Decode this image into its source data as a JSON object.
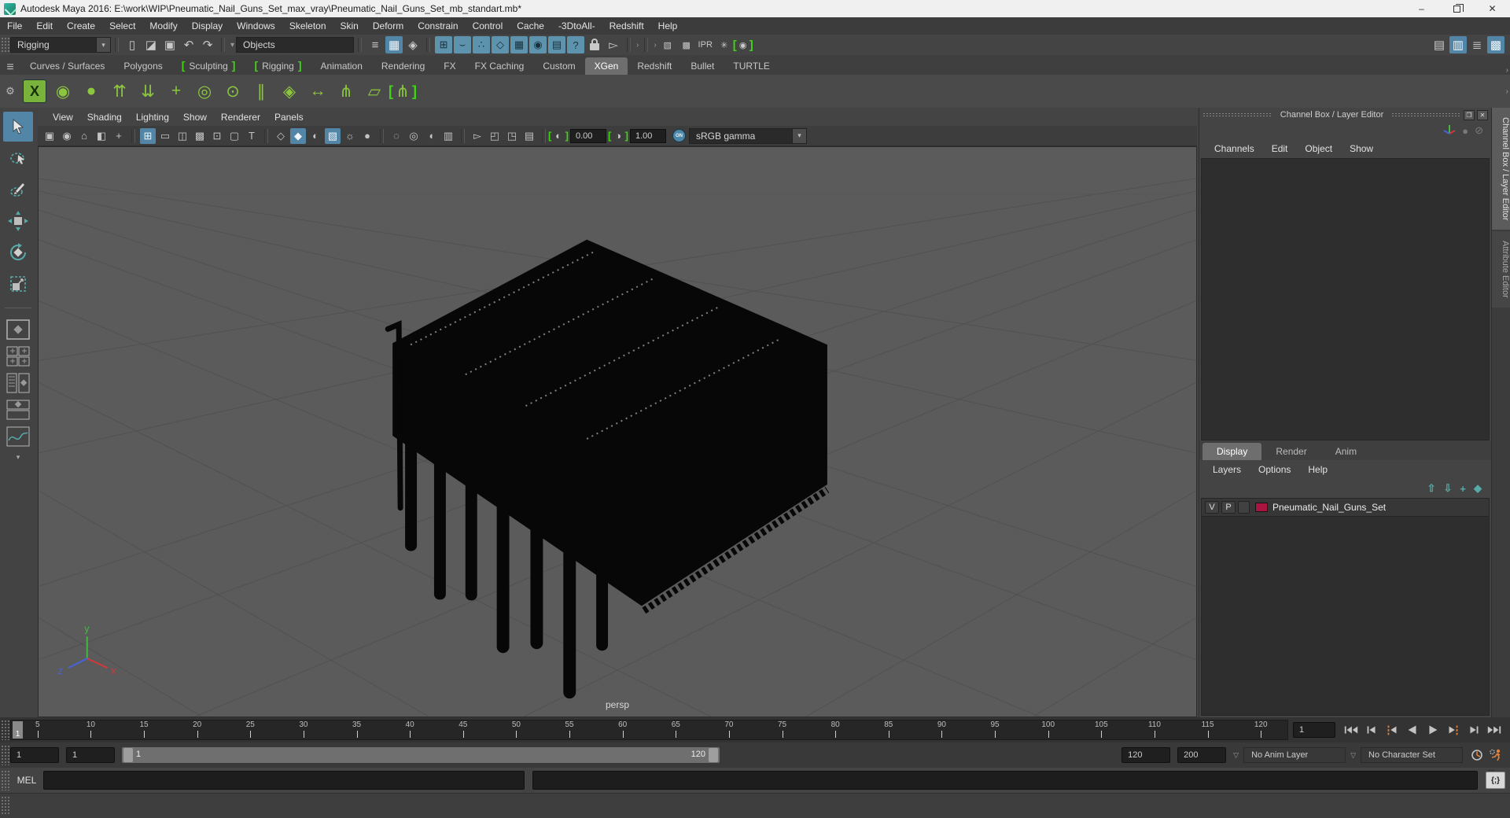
{
  "window": {
    "title": "Autodesk Maya 2016: E:\\work\\WIP\\Pneumatic_Nail_Guns_Set_max_vray\\Pneumatic_Nail_Guns_Set_mb_standart.mb*",
    "minimize_glyph": "–",
    "close_glyph": "✕"
  },
  "menu_bar": {
    "items": [
      {
        "label": "File"
      },
      {
        "label": "Edit"
      },
      {
        "label": "Create"
      },
      {
        "label": "Select"
      },
      {
        "label": "Modify"
      },
      {
        "label": "Display"
      },
      {
        "label": "Windows"
      },
      {
        "label": "Skeleton"
      },
      {
        "label": "Skin"
      },
      {
        "label": "Deform"
      },
      {
        "label": "Constrain"
      },
      {
        "label": "Control"
      },
      {
        "label": "Cache"
      },
      {
        "label": "-3DtoAll-"
      },
      {
        "label": "Redshift"
      },
      {
        "label": "Help"
      }
    ]
  },
  "status_line": {
    "menuset": "Rigging",
    "selection_mask": "Objects",
    "file_icons": [
      {
        "name": "new-scene-icon",
        "glyph": "▯"
      },
      {
        "name": "open-scene-icon",
        "glyph": "◪"
      },
      {
        "name": "save-scene-icon",
        "glyph": "▣"
      },
      {
        "name": "undo-icon",
        "glyph": "↶"
      },
      {
        "name": "redo-icon",
        "glyph": "↷"
      }
    ],
    "selection_mode_icons": [
      {
        "name": "hierarchy-mode-icon",
        "glyph": "≡"
      },
      {
        "name": "object-mode-icon",
        "glyph": "▦",
        "active": true
      },
      {
        "name": "component-mode-icon",
        "glyph": "◈"
      }
    ],
    "snap_icons": [
      {
        "name": "snap-grid-icon",
        "glyph": "⊞"
      },
      {
        "name": "snap-curve-icon",
        "glyph": "⌣"
      },
      {
        "name": "snap-point-icon",
        "glyph": "∴"
      },
      {
        "name": "snap-projected-center-icon",
        "glyph": "◇"
      },
      {
        "name": "snap-view-plane-icon",
        "glyph": "▦"
      },
      {
        "name": "make-live-icon",
        "glyph": "◉"
      },
      {
        "name": "construction-history-icon",
        "glyph": "▤"
      },
      {
        "name": "help-line-icon",
        "glyph": "?"
      }
    ],
    "render_icons": [
      {
        "name": "render-view-icon",
        "glyph": "▧"
      },
      {
        "name": "render-current-frame-icon",
        "glyph": "▩"
      },
      {
        "name": "ipr-render-icon",
        "glyph": "IPR"
      },
      {
        "name": "render-settings-icon",
        "glyph": "✳"
      },
      {
        "name": "color-management-icon",
        "glyph": "◉",
        "bracket": true
      }
    ],
    "panel_toggle_icons": [
      {
        "name": "modeling-toolkit-icon",
        "glyph": "▤"
      },
      {
        "name": "tool-settings-icon",
        "glyph": "▥",
        "active": true
      },
      {
        "name": "attribute-editor-icon",
        "glyph": "≣"
      },
      {
        "name": "channel-box-toggle-icon",
        "glyph": "▩",
        "active": true
      }
    ]
  },
  "shelf": {
    "tabs": [
      {
        "label": "Curves / Surfaces"
      },
      {
        "label": "Polygons"
      },
      {
        "label": "Sculpting",
        "bracket": true
      },
      {
        "label": "Rigging",
        "bracket": true
      },
      {
        "label": "Animation"
      },
      {
        "label": "Rendering"
      },
      {
        "label": "FX"
      },
      {
        "label": "FX Caching"
      },
      {
        "label": "Custom"
      },
      {
        "label": "XGen",
        "active": true
      },
      {
        "label": "Redshift"
      },
      {
        "label": "Bullet"
      },
      {
        "label": "TURTLE"
      }
    ],
    "tools": [
      {
        "name": "xgen-editor-icon",
        "glyph": "X",
        "boxed": true
      },
      {
        "name": "xgen-description-icon",
        "glyph": "◉"
      },
      {
        "name": "xgen-collection-icon",
        "glyph": "●"
      },
      {
        "name": "xgen-add-guides-icon",
        "glyph": "⇈"
      },
      {
        "name": "xgen-place-guides-icon",
        "glyph": "⇊"
      },
      {
        "name": "xgen-add-guide-icon",
        "glyph": "+"
      },
      {
        "name": "xgen-toggle-guide-icon",
        "glyph": "◎"
      },
      {
        "name": "xgen-lock-guide-icon",
        "glyph": "⊙"
      },
      {
        "name": "xgen-guides-icon",
        "glyph": "∥"
      },
      {
        "name": "xgen-export-patches-icon",
        "glyph": "◈"
      },
      {
        "name": "xgen-width-icon",
        "glyph": "↔"
      },
      {
        "name": "xgen-groom-icon",
        "glyph": "⋔"
      },
      {
        "name": "xgen-region-icon",
        "glyph": "▱"
      },
      {
        "name": "xgen-delete-guides-icon",
        "glyph": "⋔",
        "bracket": true
      }
    ]
  },
  "toolbox": {
    "tools": [
      "select-tool",
      "lasso-tool",
      "paint-selection-tool",
      "move-tool",
      "rotate-tool",
      "scale-tool"
    ],
    "layouts": [
      "single-pane-layout",
      "four-pane-layout",
      "outliner-persp-layout",
      "persp-outliner-layout",
      "persp-graph-layout"
    ]
  },
  "viewport": {
    "menus": [
      {
        "label": "View"
      },
      {
        "label": "Shading"
      },
      {
        "label": "Lighting"
      },
      {
        "label": "Show"
      },
      {
        "label": "Renderer"
      },
      {
        "label": "Panels"
      }
    ],
    "toolbar_g1": [
      {
        "name": "select-camera-icon",
        "glyph": "▣"
      },
      {
        "name": "camera-attributes-icon",
        "glyph": "◉"
      },
      {
        "name": "bookmark-icon",
        "glyph": "⌂"
      },
      {
        "name": "image-plane-icon",
        "glyph": "◧"
      },
      {
        "name": "two-d-pan-zoom-icon",
        "glyph": "+"
      }
    ],
    "toolbar_g2": [
      {
        "name": "grid-icon",
        "glyph": "⊞",
        "active": true
      },
      {
        "name": "film-gate-icon",
        "glyph": "▭"
      },
      {
        "name": "resolution-gate-icon",
        "glyph": "◫"
      },
      {
        "name": "gate-mask-icon",
        "glyph": "▩"
      },
      {
        "name": "field-chart-icon",
        "glyph": "⊡"
      },
      {
        "name": "safe-action-icon",
        "glyph": "▢"
      },
      {
        "name": "safe-title-icon",
        "glyph": "T"
      }
    ],
    "toolbar_g3": [
      {
        "name": "wireframe-icon",
        "glyph": "◇"
      },
      {
        "name": "smooth-shade-icon",
        "glyph": "◆",
        "active": true
      },
      {
        "name": "flat-shade-icon",
        "glyph": "◐"
      },
      {
        "name": "textured-icon",
        "glyph": "▧",
        "active": true
      },
      {
        "name": "lights-icon",
        "glyph": "☼"
      },
      {
        "name": "shadows-icon",
        "glyph": "●"
      }
    ],
    "toolbar_g4": [
      {
        "name": "xray-joints-icon",
        "glyph": "◌"
      },
      {
        "name": "xray-icon",
        "glyph": "◎"
      },
      {
        "name": "backface-culling-icon",
        "glyph": "◖"
      },
      {
        "name": "isolate-select-icon",
        "glyph": "▥"
      }
    ],
    "toolbar_g5": [
      {
        "name": "highlight-selection-icon",
        "glyph": "▻"
      },
      {
        "name": "pane-copy-icon",
        "glyph": "◰"
      },
      {
        "name": "pane-paste-icon",
        "glyph": "◳"
      },
      {
        "name": "pane-tearoff-icon",
        "glyph": "▤"
      }
    ],
    "exposure": "0.00",
    "gamma": "1.00",
    "on_label": "ON",
    "view_transform": "sRGB gamma",
    "camera_label": "persp"
  },
  "channel_box": {
    "title": "Channel Box / Layer Editor",
    "float_glyph": "❐",
    "close_glyph": "✕",
    "header_icons": [
      "manipulator-icon",
      "speed-slow-icon",
      "speed-fast-icon"
    ],
    "speed_slow_glyph": "●",
    "speed_fast_glyph": "⊘",
    "menus": [
      {
        "label": "Channels"
      },
      {
        "label": "Edit"
      },
      {
        "label": "Object"
      },
      {
        "label": "Show"
      }
    ],
    "vertical_tabs": [
      {
        "label": "Channel Box / Layer Editor",
        "active": true
      },
      {
        "label": "Attribute Editor"
      }
    ]
  },
  "layer_editor": {
    "tabs": [
      {
        "label": "Display",
        "active": true
      },
      {
        "label": "Render"
      },
      {
        "label": "Anim"
      }
    ],
    "menus": [
      {
        "label": "Layers"
      },
      {
        "label": "Options"
      },
      {
        "label": "Help"
      }
    ],
    "icons": [
      {
        "name": "move-layer-up-icon",
        "glyph": "⇧"
      },
      {
        "name": "move-layer-down-icon",
        "glyph": "⇩"
      },
      {
        "name": "new-empty-layer-icon",
        "glyph": "+"
      },
      {
        "name": "new-layer-from-selected-icon",
        "glyph": "◆"
      }
    ],
    "layer": {
      "visible": "V",
      "playback": "P",
      "name": "Pneumatic_Nail_Guns_Set",
      "color": "#a91441"
    }
  },
  "time_slider": {
    "ticks": [
      "5",
      "10",
      "15",
      "20",
      "25",
      "30",
      "35",
      "40",
      "45",
      "50",
      "55",
      "60",
      "65",
      "70",
      "75",
      "80",
      "85",
      "90",
      "95",
      "100",
      "105",
      "110",
      "115",
      "120"
    ],
    "playhead": "1",
    "current_frame": "1"
  },
  "range_slider": {
    "anim_start": "1",
    "playback_start": "1",
    "range_start": "1",
    "range_end": "120",
    "playback_end": "120",
    "anim_end": "200",
    "anim_layer": "No Anim Layer",
    "character_set": "No Character Set"
  },
  "command_line": {
    "label": "MEL",
    "script_editor_glyph": "{;}"
  },
  "colors": {
    "accent_blue": "#5285a6",
    "snap_teal": "#5e93ad",
    "shelf_green": "#8cc63f",
    "bracket_green": "#3fd512",
    "layer_swatch": "#a91441",
    "orange": "#e0823c",
    "viewport_bg": "#5b5b5b"
  }
}
